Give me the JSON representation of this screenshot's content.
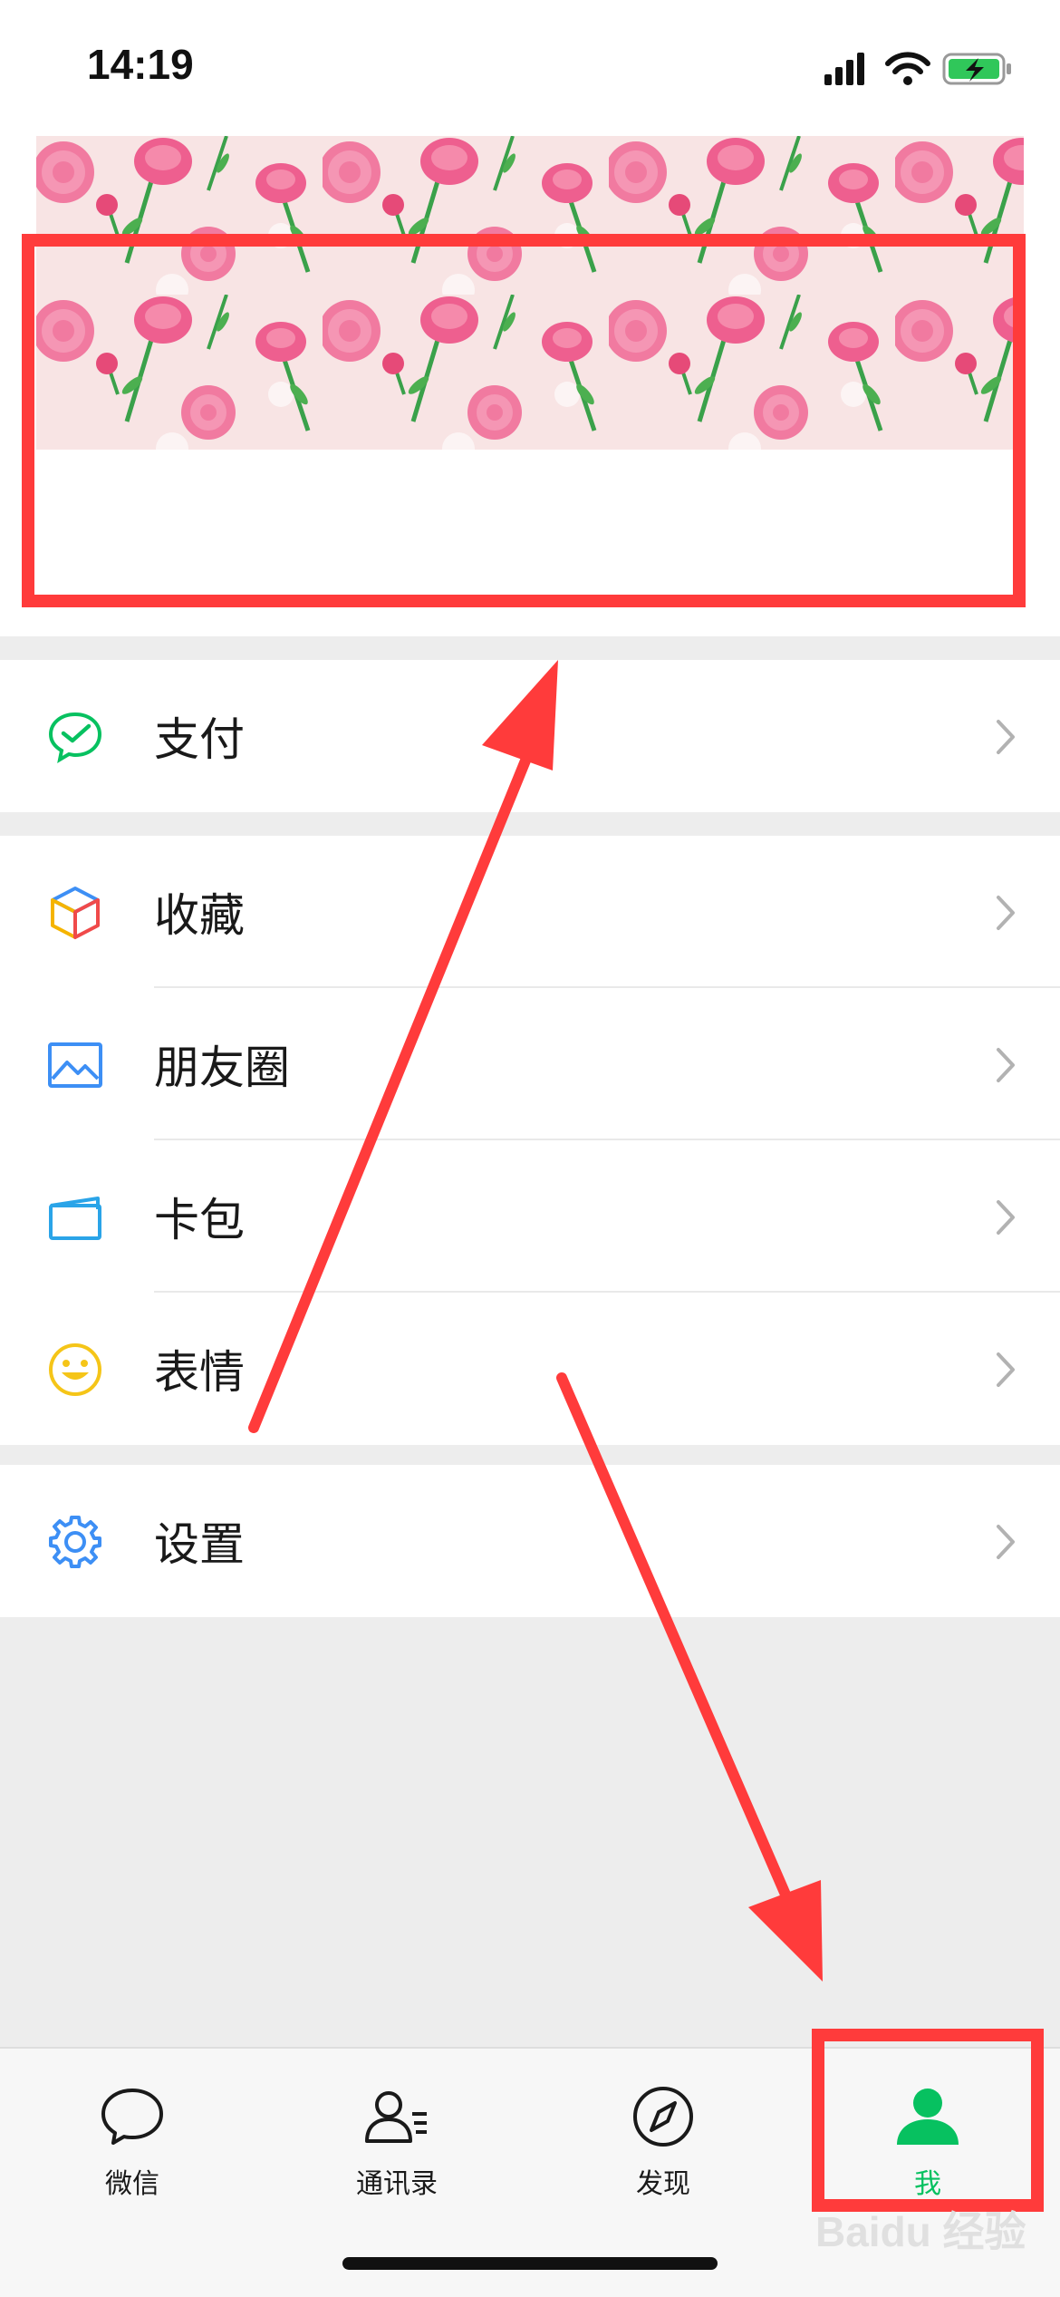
{
  "status_bar": {
    "time": "14:19"
  },
  "menu": {
    "pay": "支付",
    "favorites": "收藏",
    "moments": "朋友圈",
    "cards": "卡包",
    "stickers": "表情",
    "settings": "设置"
  },
  "tabbar": {
    "tabs": [
      {
        "label": "微信",
        "icon": "chat-bubble-icon"
      },
      {
        "label": "通讯录",
        "icon": "contacts-icon"
      },
      {
        "label": "发现",
        "icon": "compass-icon"
      },
      {
        "label": "我",
        "icon": "person-icon",
        "active": true
      }
    ]
  },
  "colors": {
    "accent": "#07c160",
    "annotation": "#ff3b3b"
  },
  "watermark": "Baidu 经验"
}
